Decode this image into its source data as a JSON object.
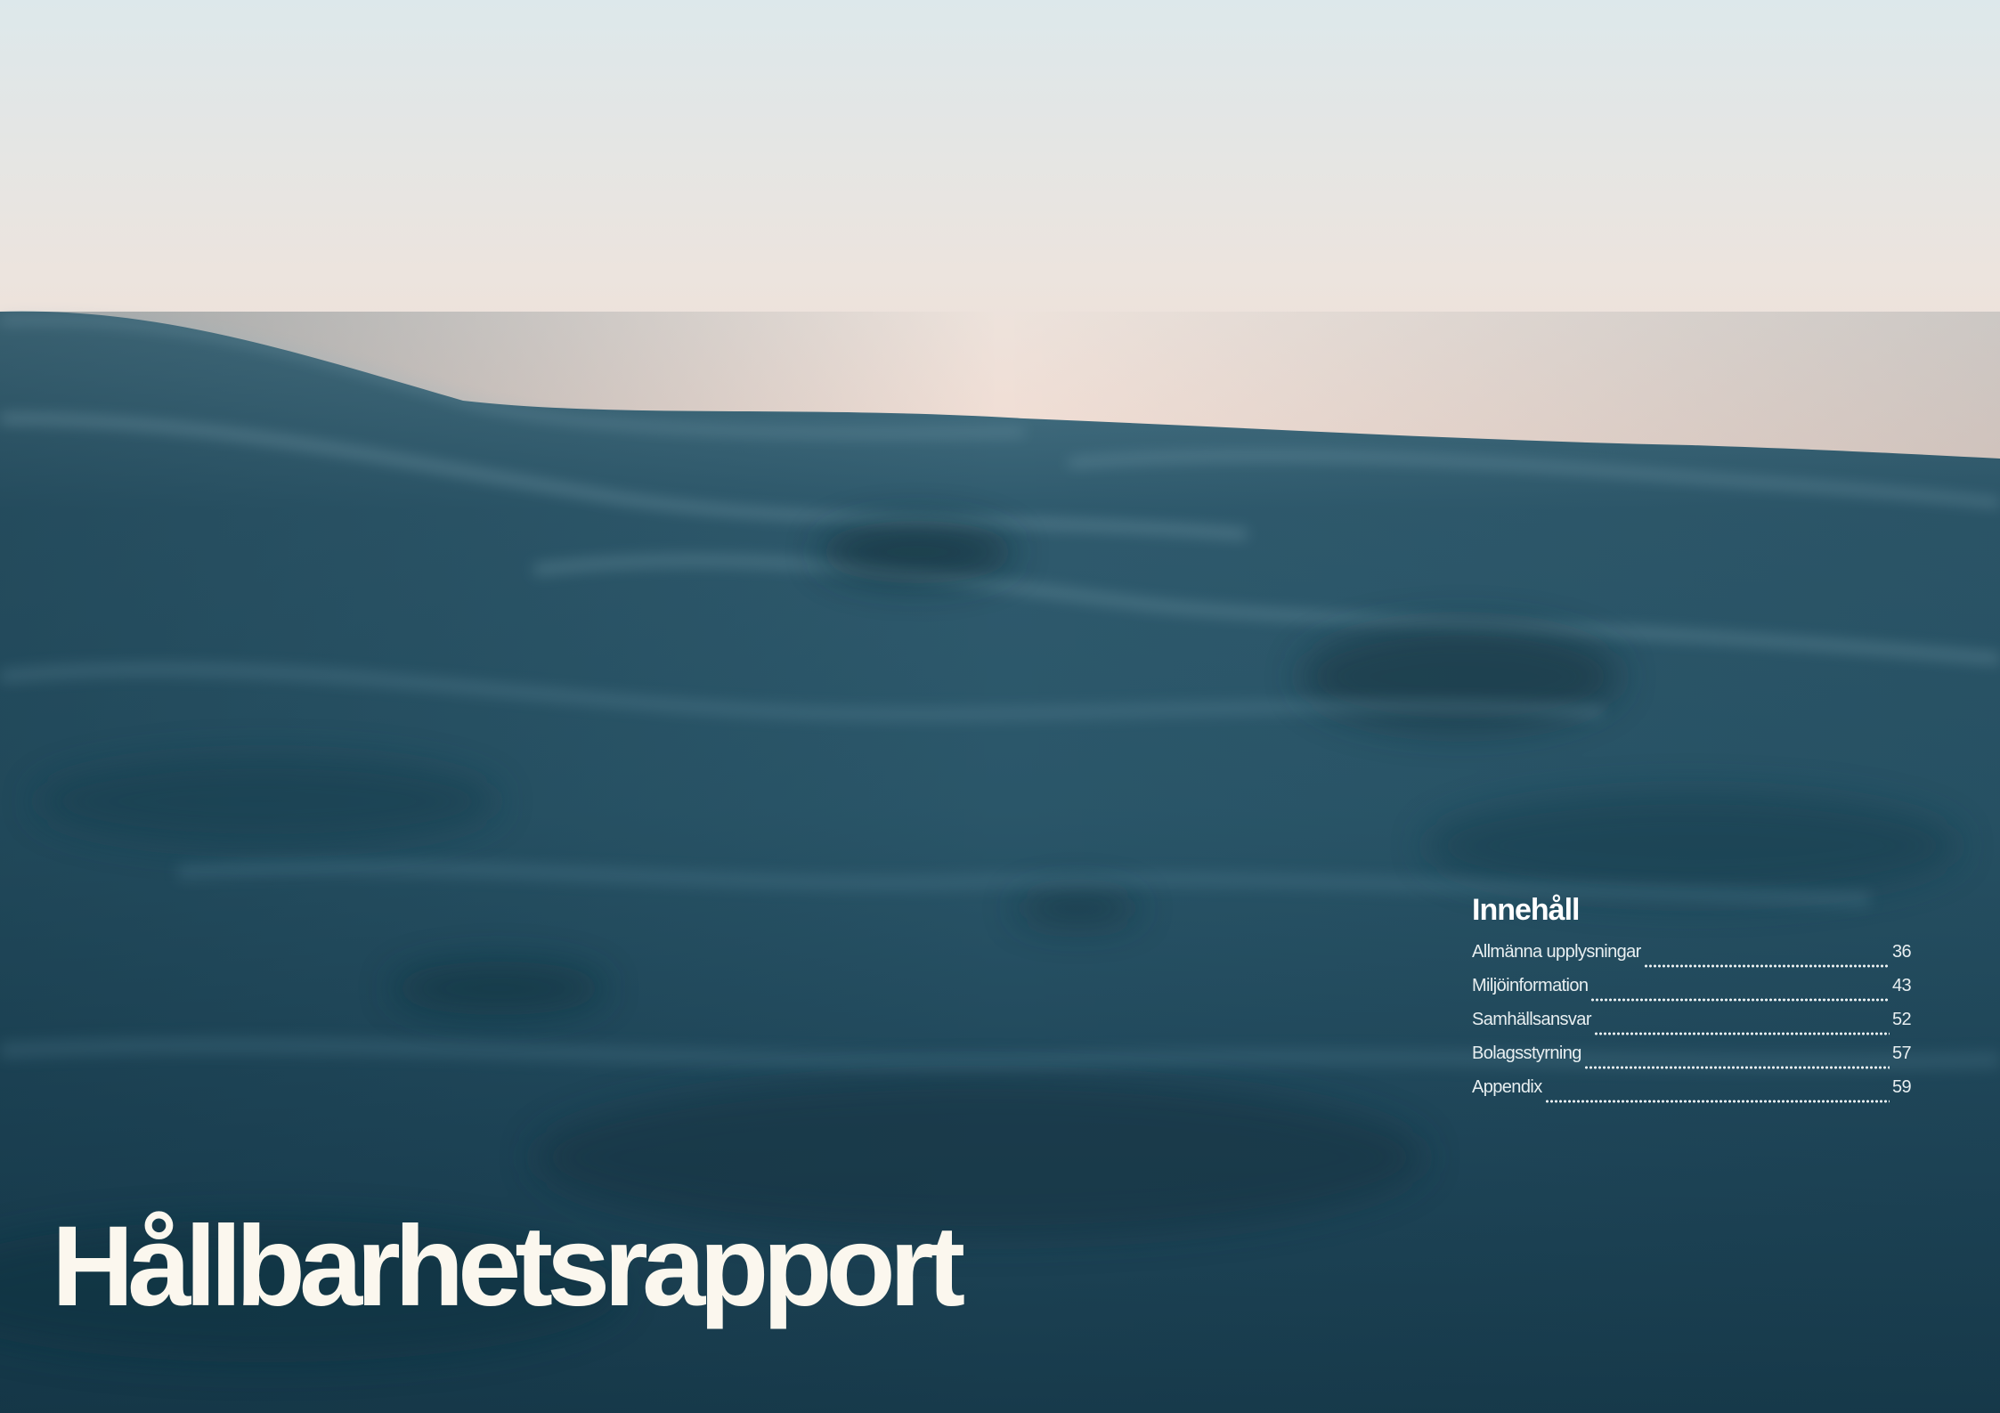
{
  "title": "Hållbarhetsrapport",
  "toc": {
    "heading": "Innehåll",
    "items": [
      {
        "label": "Allmänna upplysningar",
        "page": "36"
      },
      {
        "label": "Miljöinformation",
        "page": "43"
      },
      {
        "label": "Samhällsansvar",
        "page": "52"
      },
      {
        "label": "Bolagsstyrning",
        "page": "57"
      },
      {
        "label": "Appendix",
        "page": "59"
      }
    ]
  },
  "colors": {
    "sky_top": "#dfe9ec",
    "sky_horizon": "#f4dcd2",
    "sea_light": "#4a7588",
    "sea_dark": "#163646",
    "title_text": "#fbf7ee"
  }
}
